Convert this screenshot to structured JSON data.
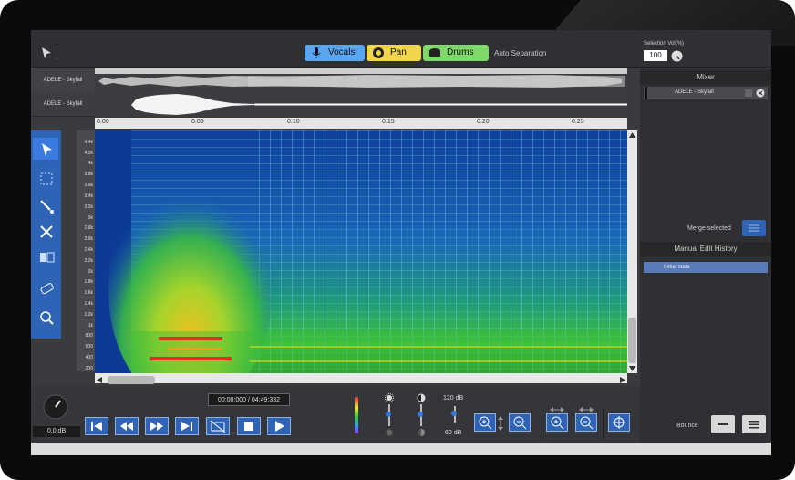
{
  "toolbar": {
    "vocals_label": "Vocals",
    "pan_label": "Pan",
    "drums_label": "Drums",
    "auto_separation": "Auto Separation",
    "selection_vol_label": "Selection Vol(%)",
    "selection_vol_value": "100"
  },
  "tracks": [
    {
      "name": "ADELE - Skyfall"
    },
    {
      "name": "ADELE - Skyfall"
    }
  ],
  "timeline": {
    "ticks": [
      "0:00",
      "0:05",
      "0:10",
      "0:15",
      "0:20",
      "0:25"
    ]
  },
  "freq_ticks": [
    "4.4k",
    "4.2k",
    "4k",
    "3.8k",
    "3.6k",
    "3.4k",
    "3.2k",
    "3k",
    "2.8k",
    "2.6k",
    "2.4k",
    "2.2k",
    "2k",
    "1.8k",
    "1.6k",
    "1.4k",
    "1.2k",
    "1k",
    "800",
    "600",
    "400",
    "200"
  ],
  "mixer": {
    "title": "Mixer",
    "track_name": "ADELE - Skyfall",
    "merge_selected": "Merge selected"
  },
  "history": {
    "title": "Manual Edit History",
    "items": [
      "Initial state"
    ]
  },
  "transport": {
    "volume": "0.0 dB",
    "time": "00:00:000 / 04:49:332",
    "db_top": "120 dB",
    "db_bottom": "60 dB",
    "bounce": "Bounce"
  },
  "colors": {
    "accent_blue": "#2e63b5",
    "vocals_btn": "#5aa6ee",
    "pan_btn": "#f1d64a",
    "drums_btn": "#7ed96a"
  }
}
